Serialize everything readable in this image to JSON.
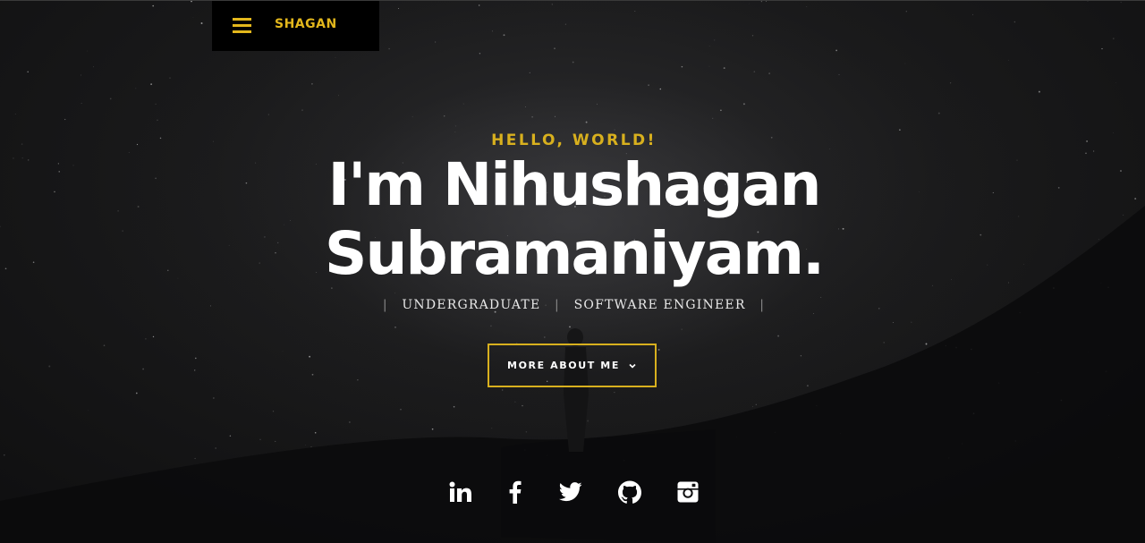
{
  "nav": {
    "brand": "SHAGAN",
    "menu_icon": "hamburger-menu-icon"
  },
  "hero": {
    "greeting": "HELLO, WORLD!",
    "headline_line1": "I'm Nihushagan",
    "headline_line2": "Subramaniyam.",
    "roles": [
      "UNDERGRADUATE",
      "SOFTWARE ENGINEER"
    ],
    "role_separator": "|",
    "cta_label": "MORE ABOUT ME",
    "cta_icon": "chevron-down-icon"
  },
  "social": {
    "links": [
      {
        "icon": "linkedin-icon"
      },
      {
        "icon": "facebook-icon"
      },
      {
        "icon": "twitter-icon"
      },
      {
        "icon": "github-icon"
      },
      {
        "icon": "instagram-icon"
      }
    ]
  },
  "colors": {
    "accent": "#e3b71c",
    "background": "#0f0f10",
    "text": "#ffffff"
  }
}
